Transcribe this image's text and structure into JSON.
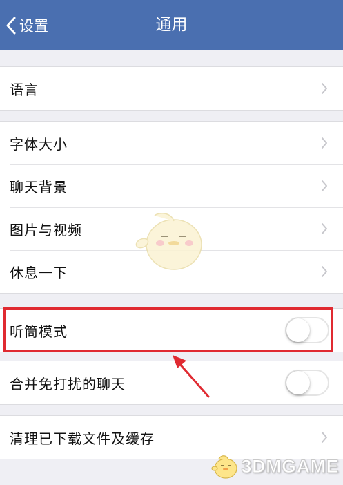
{
  "navbar": {
    "back_label": "设置",
    "title": "通用",
    "background": "#4a6fb0"
  },
  "groups": [
    {
      "items": [
        {
          "label": "语言",
          "accessory": "chevron"
        }
      ]
    },
    {
      "items": [
        {
          "label": "字体大小",
          "accessory": "chevron"
        },
        {
          "label": "聊天背景",
          "accessory": "chevron"
        },
        {
          "label": "图片与视频",
          "accessory": "chevron"
        },
        {
          "label": "休息一下",
          "accessory": "chevron"
        }
      ]
    },
    {
      "items": [
        {
          "label": "听筒模式",
          "accessory": "toggle",
          "on": false
        }
      ]
    },
    {
      "items": [
        {
          "label": "合并免打扰的聊天",
          "accessory": "toggle",
          "on": false
        }
      ]
    },
    {
      "items": [
        {
          "label": "清理已下载文件及缓存",
          "accessory": "chevron"
        }
      ]
    }
  ],
  "annotation": {
    "color": "#e02a31",
    "target": "听筒模式"
  },
  "watermark": {
    "text": "3DMGAME",
    "icon": "mascot-icon"
  },
  "colors": {
    "page_background": "#efeff4",
    "chevron": "#c7c7cc"
  }
}
